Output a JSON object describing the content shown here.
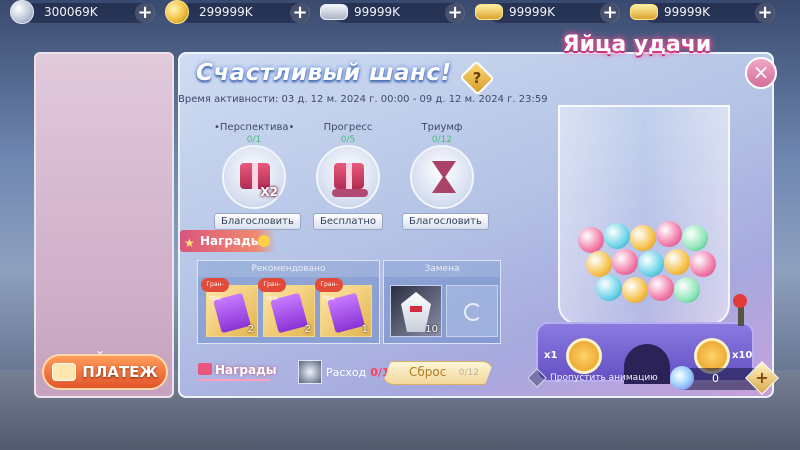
{
  "currencies": [
    {
      "value": "300069K",
      "icon": "silver-coin-icon"
    },
    {
      "value": "299999K",
      "icon": "gold-coin-icon"
    },
    {
      "value": "99999K",
      "icon": "silver-ingot-icon"
    },
    {
      "value": "99999K",
      "icon": "gold-ingot-icon"
    },
    {
      "value": "99999K",
      "icon": "gold-ingot-icon"
    }
  ],
  "sidebar": {
    "pay_button": "ПЛАТЕЖ"
  },
  "event": {
    "title": "Счастливый шанс!",
    "help": "?",
    "time": "Время активности: 03 д. 12 м. 2024 г. 00:00 - 09 д. 12 м. 2024 г. 23:59",
    "slots": [
      {
        "label": "•Перспектива•",
        "count": "0/1",
        "button": "Благословить",
        "badge": "X2"
      },
      {
        "label": "Прогресс",
        "count": "0/5",
        "button": "Бесплатно"
      },
      {
        "label": "Триумф",
        "count": "0/12",
        "button": "Благословить"
      }
    ],
    "rewards_tag": "Награды",
    "recommended": {
      "header": "Рекомендовано",
      "items": [
        {
          "badge": "Гран-при",
          "qty": "2"
        },
        {
          "badge": "Гран-при",
          "qty": "2"
        },
        {
          "badge": "Гран-при",
          "qty": "1"
        }
      ]
    },
    "replace": {
      "header": "Замена",
      "items": [
        {
          "qty": "10"
        },
        {
          "qty": ""
        }
      ]
    },
    "rewards_link": "Награды",
    "cost": {
      "label": "Расход",
      "value": "0/1"
    },
    "reset": {
      "label": "Сброс",
      "count": "0/12"
    }
  },
  "machine": {
    "banner": "Яйца удачи",
    "x1": "x1",
    "x10": "x10",
    "skip_label": "Пропустить анимацию",
    "balance": "0",
    "plus": "+",
    "close": "×"
  }
}
